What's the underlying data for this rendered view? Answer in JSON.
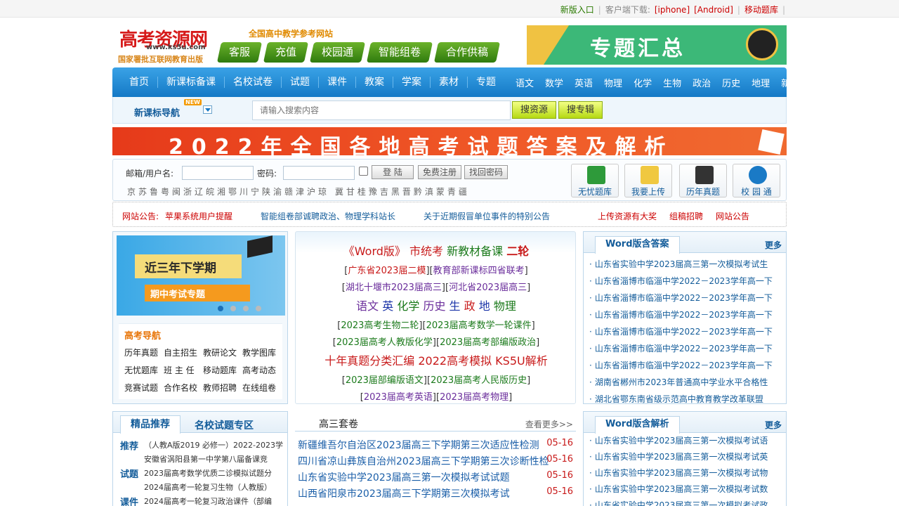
{
  "topbar": {
    "new_entry": "新版入口",
    "client": "客户端下载:",
    "iphone": "[iphone]",
    "android": "[Android]",
    "mobile": "移动题库"
  },
  "header": {
    "logo_text": "高考资源网",
    "logo_url": "www.ks5u.com",
    "license": "国家署批互联网教育出版",
    "slogan": "全国高中教学参考网站",
    "buttons": [
      "客服",
      "充值",
      "校园通",
      "智能组卷",
      "合作供稿"
    ],
    "banner_text": "专题汇总"
  },
  "nav": {
    "main": [
      "首页",
      "新课标备课",
      "名校试卷",
      "试题",
      "课件",
      "教案",
      "学案",
      "素材",
      "专题"
    ],
    "subjects": [
      "语文",
      "数学",
      "英语",
      "物理",
      "化学",
      "生物",
      "政治",
      "历史",
      "地理"
    ],
    "newbie": "新手"
  },
  "search": {
    "nav_label": "新课标导航",
    "new_badge": "NEW",
    "placeholder": "请输入搜索内容",
    "btn_resource": "搜资源",
    "btn_album": "搜专辑"
  },
  "banner": {
    "text": "2022年全国各地高考试题答案及解析"
  },
  "login": {
    "user_label": "邮箱/用户名:",
    "pass_label": "密码:",
    "login_btn": "登 陆",
    "register_btn": "免费注册",
    "forgot_btn": "找回密码",
    "provinces": "京苏鲁粤闽浙辽皖湘鄂川宁陕渝赣津沪琼 冀甘桂豫吉黑晋黔滇蒙青疆",
    "tools": [
      "无忧题库",
      "我要上传",
      "历年真题",
      "校 园 通"
    ]
  },
  "notice": {
    "label": "网站公告:",
    "items": [
      "苹果系统用户提醒",
      "智能组卷部诚聘政治、物理学科站长",
      "关于近期假冒单位事件的特别公告",
      "上传资源有大奖",
      "组稿招聘",
      "网站公告"
    ]
  },
  "slide": {
    "title": "近三年下学期",
    "subtitle": "期中考试专题"
  },
  "gk_nav": {
    "title": "高考导航",
    "links": [
      "历年真题",
      "自主招生",
      "教研论文",
      "教学图库",
      "无忧题库",
      "班 主 任",
      "移动题库",
      "高考动态",
      "竞赛试题",
      "合作名校",
      "教师招聘",
      "在线组卷"
    ]
  },
  "center": {
    "line1": {
      "a": "《Word版》",
      "b": "市统考",
      "c": "新教材备课",
      "d": "二轮"
    },
    "line2": [
      "广东省2023届二模",
      "教育部新课标四省联考"
    ],
    "line3": [
      "湖北十堰市2023届高三",
      "河北省2023届高三"
    ],
    "line4": [
      "语文",
      "英",
      "化学",
      "历史",
      "生",
      "政",
      "地",
      "物理"
    ],
    "line5": [
      "2023高考生物二轮",
      "2023届高考数学一轮课件"
    ],
    "line6": [
      "2023届高考人教版化学",
      "2023届高考部编版政治"
    ],
    "line7": "十年真题分类汇编 2022高考模拟 KS5U解析",
    "line8": [
      "2023届部编版语文",
      "2023届高考人民版历史"
    ],
    "line9": [
      "2023届高考英语",
      "2023届高考物理"
    ]
  },
  "answers": {
    "title": "Word版含答案",
    "more": "更多",
    "items": [
      "山东省实验中学2023届高三第一次模拟考试生",
      "山东省淄博市临淄中学2022－2023学年高一下",
      "山东省淄博市临淄中学2022－2023学年高一下",
      "山东省淄博市临淄中学2022－2023学年高一下",
      "山东省淄博市临淄中学2022－2023学年高一下",
      "山东省淄博市临淄中学2022－2023学年高一下",
      "山东省淄博市临淄中学2022－2023学年高一下",
      "湖南省郴州市2023年普通高中学业水平合格性",
      "湖北省鄂东南省级示范高中教育教学改革联盟"
    ]
  },
  "recommend": {
    "tab1": "精品推荐",
    "tab2": "名校试题专区",
    "cats": [
      "推荐",
      "试题",
      "课件"
    ],
    "items": [
      "（人教A版2019 必修一）2022-2023学",
      "安徽省涡阳县第一中学第八届备课竞",
      "2023届高考数学优质二诊模拟试题分",
      "2024届高考一轮复习生物（人教版）",
      "2024届高考一轮复习政治课件（部编"
    ]
  },
  "suites": {
    "title": "高三套卷",
    "more": "查看更多>>",
    "items": [
      {
        "name": "新疆维吾尔自治区2023届高三下学期第三次适应性检测",
        "date": "05-16"
      },
      {
        "name": "四川省凉山彝族自治州2023届高三下学期第三次诊断性检",
        "date": "05-16"
      },
      {
        "name": "山东省实验中学2023届高三第一次模拟考试试题",
        "date": "05-16"
      },
      {
        "name": "山西省阳泉市2023届高三下学期第三次模拟考试",
        "date": "05-16"
      }
    ]
  },
  "analysis": {
    "title": "Word版含解析",
    "more": "更多",
    "items": [
      "山东省实验中学2023届高三第一次模拟考试语",
      "山东省实验中学2023届高三第一次模拟考试英",
      "山东省实验中学2023届高三第一次模拟考试物",
      "山东省实验中学2023届高三第一次模拟考试数",
      "山东省实验中学2023届高三第一次模拟考试政"
    ]
  }
}
